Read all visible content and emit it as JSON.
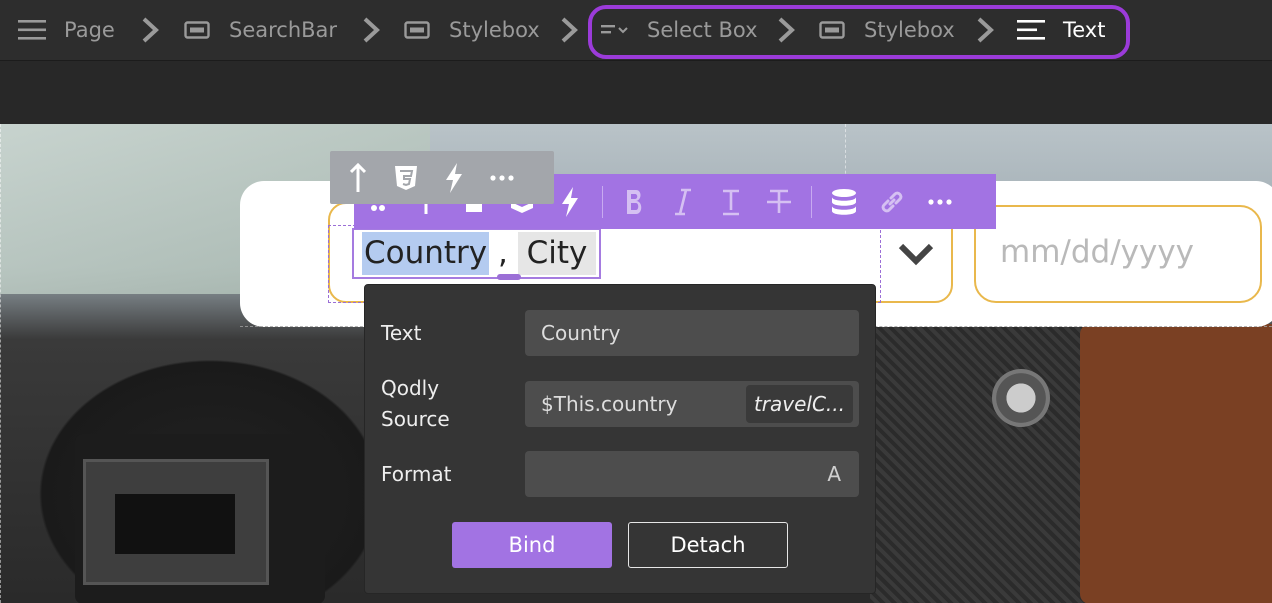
{
  "breadcrumb": {
    "items": [
      {
        "label": "Page"
      },
      {
        "label": "SearchBar"
      },
      {
        "label": "Stylebox"
      },
      {
        "label": "Select Box"
      },
      {
        "label": "Stylebox"
      },
      {
        "label": "Text"
      }
    ]
  },
  "canvas": {
    "text_tokens": [
      "Country",
      ",",
      "City"
    ],
    "date_placeholder": "mm/dd/yyyy"
  },
  "panel": {
    "text_label": "Text",
    "text_value": "Country",
    "source_label_line1": "Qodly",
    "source_label_line2": "Source",
    "source_value": "$This.country",
    "source_badge": "travelC...",
    "format_label": "Format",
    "format_value": "",
    "format_icon_letter": "A",
    "bind_label": "Bind",
    "detach_label": "Detach"
  },
  "colors": {
    "accent": "#a273e3",
    "highlight": "#9b3bd9",
    "field_border": "#e9b84c",
    "panel_bg": "#353535"
  },
  "icons": [
    "hamburger-icon",
    "chevron-right-icon",
    "stylebox-icon",
    "select-box-icon",
    "text-lines-icon",
    "arrow-up-icon",
    "css3-icon",
    "lightning-icon",
    "ellipsis-icon",
    "drag-handle-icon",
    "bold-icon",
    "italic-icon",
    "text-t-icon",
    "strikethrough-icon",
    "database-icon",
    "link-icon",
    "chevron-down-icon"
  ]
}
